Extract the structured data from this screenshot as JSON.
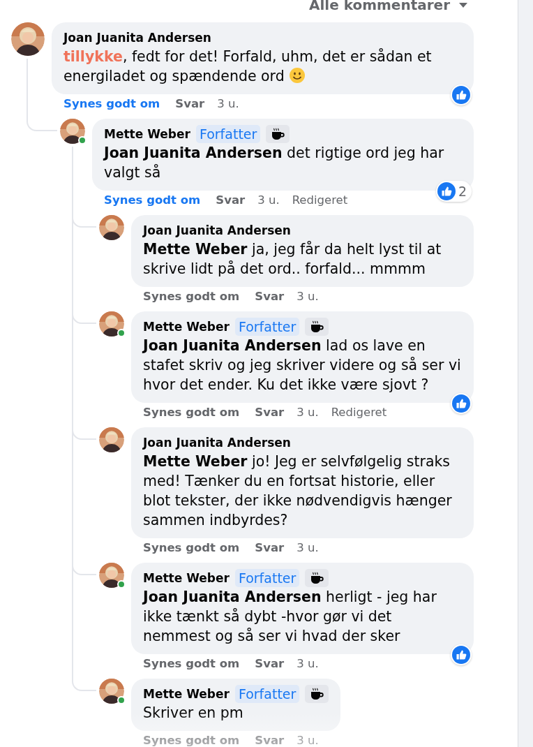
{
  "header": {
    "filter_label": "Alle kommentarer"
  },
  "comments": [
    {
      "author": "Joan Juanita Andersen",
      "online": false,
      "body": [
        {
          "kind": "highlight",
          "text": "tillykke"
        },
        {
          "kind": "plain",
          "text": ", fedt for det! Forfald, uhm, det er sådan et energiladet og spændende ord "
        },
        {
          "kind": "smiley"
        }
      ],
      "reaction": {
        "kind": "like"
      },
      "actions": {
        "like": "Synes godt om",
        "liked": true,
        "reply": "Svar",
        "time": "3 u."
      },
      "replies": [
        {
          "author": "Mette Weber",
          "online": true,
          "badges": [
            {
              "kind": "label",
              "text": "Forfatter"
            },
            {
              "kind": "coffee"
            }
          ],
          "body": [
            {
              "kind": "mention",
              "text": "Joan Juanita Andersen"
            },
            {
              "kind": "plain",
              "text": " det rigtige ord jeg har valgt så"
            }
          ],
          "reaction": {
            "kind": "like",
            "count": "2"
          },
          "actions": {
            "like": "Synes godt om",
            "liked": true,
            "reply": "Svar",
            "time": "3 u.",
            "edited": "Redigeret"
          },
          "replies": [
            {
              "author": "Joan Juanita Andersen",
              "online": false,
              "body": [
                {
                  "kind": "mention",
                  "text": "Mette Weber"
                },
                {
                  "kind": "plain",
                  "text": " ja, jeg får da helt lyst til at skrive lidt på det ord.. forfald... mmmm"
                }
              ],
              "actions": {
                "like": "Synes godt om",
                "liked": false,
                "reply": "Svar",
                "time": "3 u."
              }
            },
            {
              "author": "Mette Weber",
              "online": true,
              "badges": [
                {
                  "kind": "label",
                  "text": "Forfatter"
                },
                {
                  "kind": "coffee"
                }
              ],
              "body": [
                {
                  "kind": "mention",
                  "text": "Joan Juanita Andersen"
                },
                {
                  "kind": "plain",
                  "text": " lad os lave en stafet skriv og jeg skriver videre og så ser vi hvor det ender. Ku det ikke være sjovt ?"
                }
              ],
              "reaction": {
                "kind": "like"
              },
              "actions": {
                "like": "Synes godt om",
                "liked": false,
                "reply": "Svar",
                "time": "3 u.",
                "edited": "Redigeret"
              }
            },
            {
              "author": "Joan Juanita Andersen",
              "online": false,
              "body": [
                {
                  "kind": "mention",
                  "text": "Mette Weber"
                },
                {
                  "kind": "plain",
                  "text": " jo! Jeg er selvfølgelig straks med! Tænker du en fortsat historie, eller blot tekster, der ikke nødvendigvis hænger sammen indbyrdes?"
                }
              ],
              "actions": {
                "like": "Synes godt om",
                "liked": false,
                "reply": "Svar",
                "time": "3 u."
              }
            },
            {
              "author": "Mette Weber",
              "online": true,
              "badges": [
                {
                  "kind": "label",
                  "text": "Forfatter"
                },
                {
                  "kind": "coffee"
                }
              ],
              "body": [
                {
                  "kind": "mention",
                  "text": "Joan Juanita Andersen"
                },
                {
                  "kind": "plain",
                  "text": " herligt - jeg har ikke tænkt så dybt -hvor gør vi det nemmest og så ser vi hvad der sker"
                }
              ],
              "reaction": {
                "kind": "like"
              },
              "actions": {
                "like": "Synes godt om",
                "liked": false,
                "reply": "Svar",
                "time": "3 u."
              }
            },
            {
              "author": "Mette Weber",
              "online": true,
              "badges": [
                {
                  "kind": "label",
                  "text": "Forfatter"
                },
                {
                  "kind": "coffee"
                }
              ],
              "body": [
                {
                  "kind": "plain",
                  "text": "Skriver en pm"
                }
              ],
              "actions": {
                "like": "Synes godt om",
                "liked": false,
                "reply": "Svar",
                "time": "3 u."
              }
            }
          ]
        }
      ]
    }
  ]
}
